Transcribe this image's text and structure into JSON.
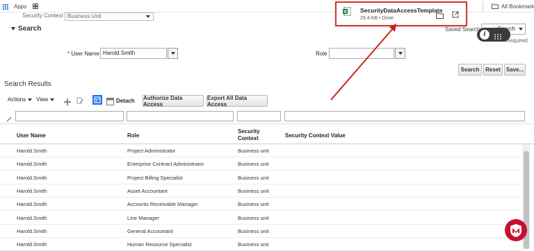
{
  "bookmarks_bar": {
    "apps_label": "Apps",
    "all_bookmarks_label": "All Bookmarks"
  },
  "search_panel": {
    "security_context_label": "Security Context",
    "security_context_value": "Business Unit",
    "title": "Search",
    "saved_search_label": "Saved Search",
    "saved_search_value": "Search",
    "required_label": "Required",
    "required_marker": "*",
    "user_name_label": "User Name",
    "user_name_value": "Harold.Smith",
    "role_label": "Role",
    "role_value": "",
    "search_button": "Search",
    "reset_button": "Reset",
    "save_button": "Save..."
  },
  "results": {
    "title": "Search Results",
    "toolbar": {
      "actions_label": "Actions",
      "view_label": "View",
      "detach_label": "Detach",
      "authorize_button": "Authorize Data Access",
      "export_button": "Export All Data Access"
    },
    "columns": {
      "user_name": "User Name",
      "role": "Role",
      "security_context_line1": "Security",
      "security_context_line2": "Context",
      "security_context_value": "Security Context Value"
    },
    "rows": [
      {
        "user": "Harold.Smith",
        "role": "Project Administrator",
        "context": "Business unit",
        "value": ""
      },
      {
        "user": "Harold.Smith",
        "role": "Enterprise Contract Administrator",
        "context": "Business unit",
        "value": ""
      },
      {
        "user": "Harold.Smith",
        "role": "Project Billing Specialist",
        "context": "Business unit",
        "value": ""
      },
      {
        "user": "Harold.Smith",
        "role": "Asset Accountant",
        "context": "Business unit",
        "value": ""
      },
      {
        "user": "Harold.Smith",
        "role": "Accounts Receivable Manager",
        "context": "Business unit",
        "value": ""
      },
      {
        "user": "Harold.Smith",
        "role": "Line Manager",
        "context": "Business unit",
        "value": ""
      },
      {
        "user": "Harold.Smith",
        "role": "General Accountant",
        "context": "Business unit",
        "value": ""
      },
      {
        "user": "Harold.Smith",
        "role": "Human Resource Specialist",
        "context": "Business unit",
        "value": ""
      }
    ]
  },
  "download_popup": {
    "file_name": "SecurityDataAccessTemplate",
    "file_info": "29.4 KB • Done",
    "file_icon": "excel-file-icon",
    "highlight_color": "#d23a2a"
  },
  "colors": {
    "accent_blue": "#1a73e8",
    "annotation_red": "#c8201b",
    "mcafee_red": "#c8102e"
  }
}
